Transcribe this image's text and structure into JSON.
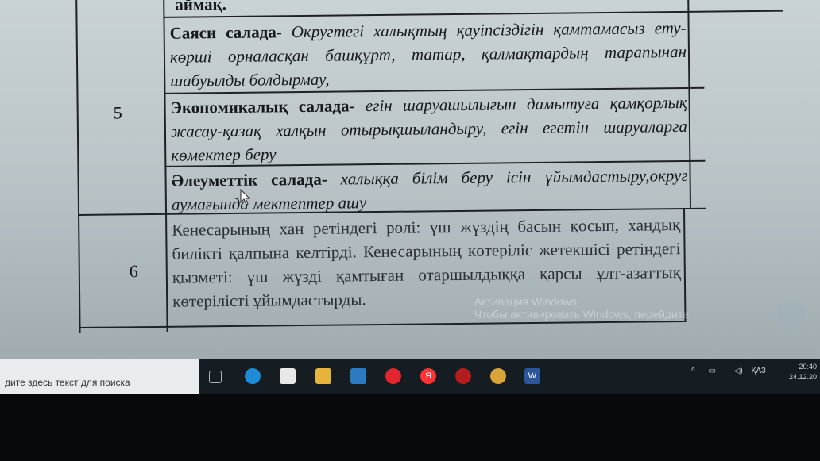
{
  "document": {
    "top_fragment": "аймақ.",
    "rows": [
      {
        "number": "5",
        "cells": [
          {
            "lead": "Саяси салада-",
            "text": "Округтегі халықтың қауіпсіздігін қамтамасыз ету-көрші орналасқан башқұрт, татар, қалмақтардың тарапынан шабуылды болдырмау,"
          },
          {
            "lead": "Экономикалық салада-",
            "text": "егін шаруашылығын дамытуға қамқорлық жасау-қазақ халқын отырықшыландыру, егін егетін шаруаларға көмектер беру"
          },
          {
            "lead": "Әлеуметтік салада-",
            "text": "халыққа білім беру ісін ұйымдастыру,округ аумағында мектептер ашу"
          }
        ]
      },
      {
        "number": "6",
        "text": "Кенесарының хан ретіндегі рөлі: үш жүздің басын қосып, хандық билікті қалпына келтірді. Кенесарының көтеріліс жетекшісі ретіндегі қызметі: үш жүзді қамтыған отаршылдыққа қарсы ұлт-азаттық көтерілісті ұйымдастырды."
      }
    ]
  },
  "watermark": {
    "line1": "Активация Windows",
    "line2": "Чтобы активировать Windows, перейдите"
  },
  "taskbar": {
    "search_placeholder": "дите здесь текст для поиска",
    "language": "ҚАЗ",
    "time": "20:40",
    "date": "24.12.20"
  }
}
